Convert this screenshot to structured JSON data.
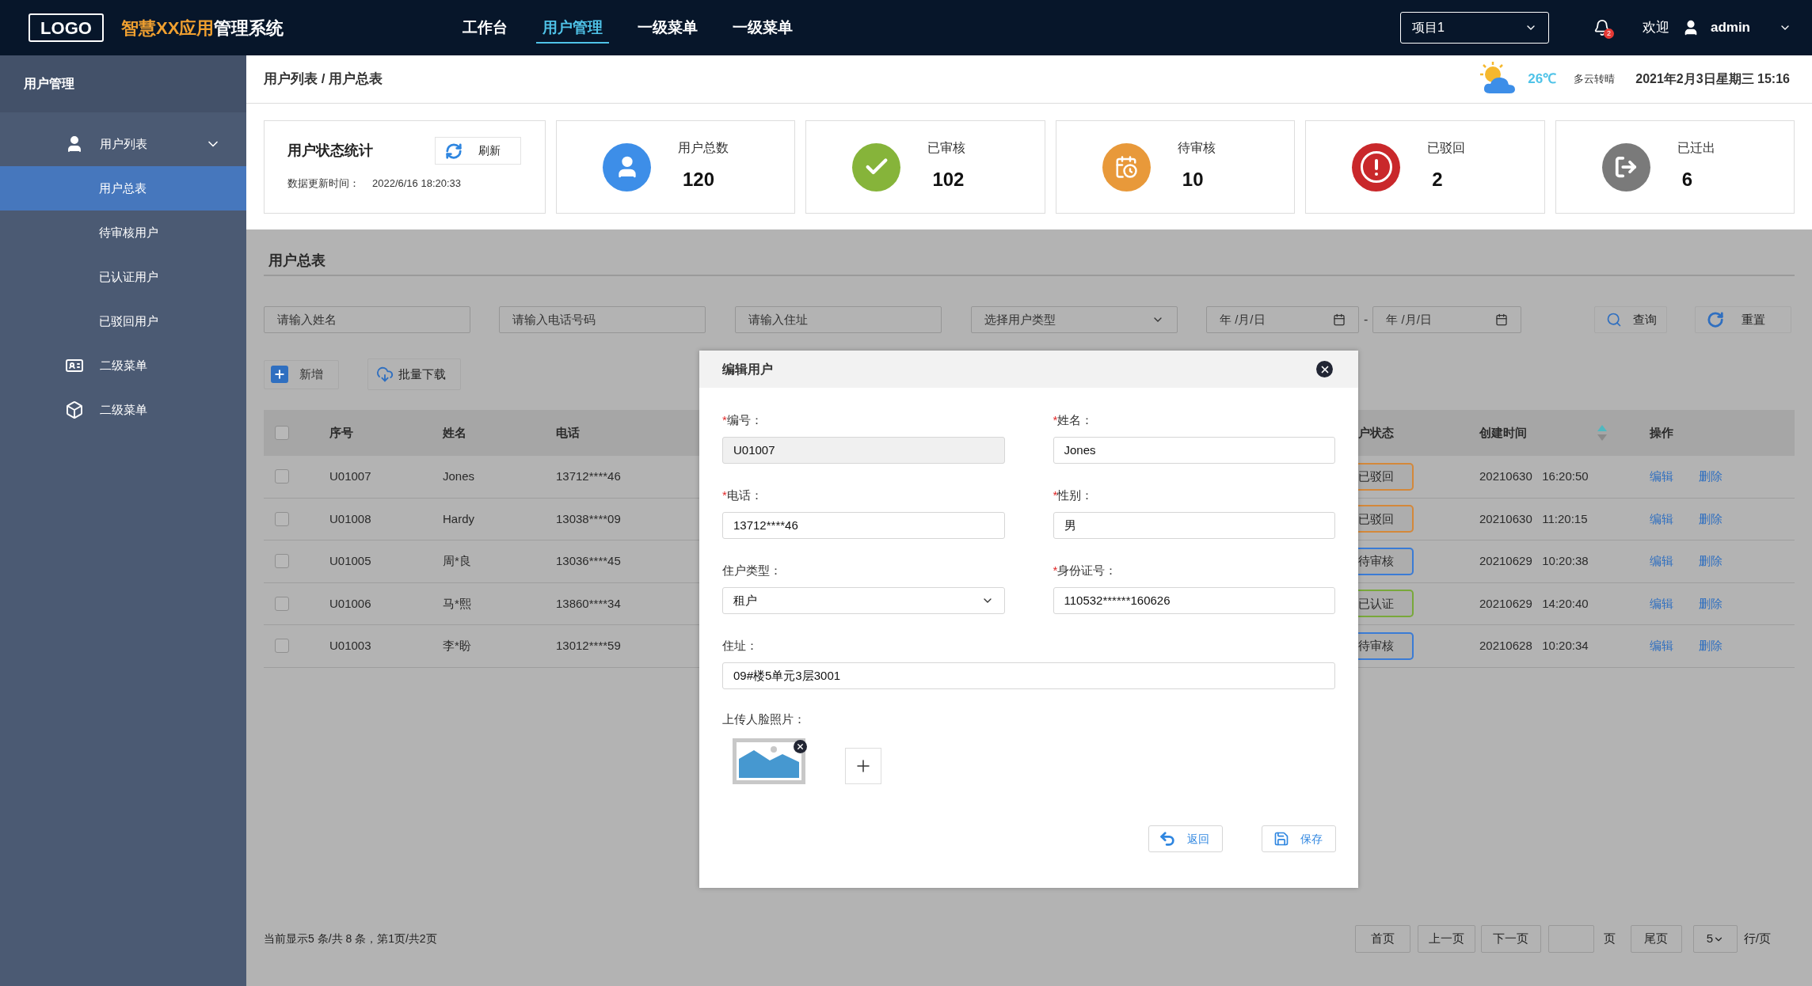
{
  "header": {
    "logo": "LOGO",
    "title_accent": "智慧XX应用",
    "title_rest": "管理系统",
    "nav": [
      {
        "label": "工作台",
        "selected": false
      },
      {
        "label": "用户管理",
        "selected": true
      },
      {
        "label": "一级菜单",
        "selected": false
      },
      {
        "label": "一级菜单",
        "selected": false
      }
    ],
    "project": "项目1",
    "notification_count": "2",
    "welcome": "欢迎",
    "user": "admin"
  },
  "sidebar": {
    "title": "用户管理",
    "items": [
      {
        "label": "用户列表",
        "expanded": true,
        "children": [
          {
            "label": "用户总表",
            "selected": true
          },
          {
            "label": "待审核用户",
            "selected": false
          },
          {
            "label": "已认证用户",
            "selected": false
          },
          {
            "label": "已驳回用户",
            "selected": false
          }
        ]
      },
      {
        "label": "二级菜单"
      },
      {
        "label": "二级菜单"
      }
    ]
  },
  "breadcrumb": "用户列表 / 用户总表",
  "weather": {
    "temperature": "26℃",
    "condition": "多云转晴"
  },
  "datetime": "2021年2月3日星期三 15:16",
  "stats": {
    "title": "用户状态统计",
    "refresh": "刷新",
    "updated_label": "数据更新时间：",
    "updated_value": "2022/6/16 18:20:33",
    "cards": [
      {
        "label": "用户总数",
        "value": "120"
      },
      {
        "label": "已审核",
        "value": "102"
      },
      {
        "label": "待审核",
        "value": "10"
      },
      {
        "label": "已驳回",
        "value": "2"
      },
      {
        "label": "已迁出",
        "value": "6"
      }
    ]
  },
  "section_title": "用户总表",
  "filters": {
    "name_placeholder": "请输入姓名",
    "phone_placeholder": "请输入电话号码",
    "address_placeholder": "请输入住址",
    "type_placeholder": "选择用户类型",
    "date_from": "年 /月/日",
    "separator": "-",
    "date_to": "年 /月/日",
    "search": "查询",
    "reset": "重置"
  },
  "actions": {
    "add": "新增",
    "download": "批量下载"
  },
  "table": {
    "select_all": {
      "checked": false
    },
    "columns": [
      {
        "label": "序号"
      },
      {
        "label": "姓名"
      },
      {
        "label": "电话"
      },
      {
        "label": "户状态"
      },
      {
        "label": "创建时间",
        "sort_ascending": true
      },
      {
        "label": "操作"
      }
    ],
    "rows": [
      {
        "checked": false,
        "id": "U01007",
        "name": "Jones",
        "phone": "13712****46",
        "status": "已驳回",
        "color": "#d4883a",
        "created": "20210630   16:20:50",
        "edit": "编辑",
        "delete": "删除"
      },
      {
        "checked": false,
        "id": "U01008",
        "name": "Hardy",
        "phone": "13038****09",
        "status": "已驳回",
        "color": "#d4883a",
        "created": "20210630   11:20:15",
        "edit": "编辑",
        "delete": "删除"
      },
      {
        "checked": false,
        "id": "U01005",
        "name": "周*良",
        "phone": "13036****45",
        "status": "待审核",
        "color": "#3a7bd5",
        "created": "20210629   10:20:38",
        "edit": "编辑",
        "delete": "删除"
      },
      {
        "checked": false,
        "id": "U01006",
        "name": "马*熙",
        "phone": "13860****34",
        "status": "已认证",
        "color": "#78a83a",
        "created": "20210629   14:20:40",
        "edit": "编辑",
        "delete": "删除"
      },
      {
        "checked": false,
        "id": "U01003",
        "name": "李*盼",
        "phone": "13012****59",
        "status": "待审核",
        "color": "#3a7bd5",
        "created": "20210628   10:20:34",
        "edit": "编辑",
        "delete": "删除"
      }
    ]
  },
  "pagination": {
    "summary": "当前显示5 条/共 8 条，第1页/共2页",
    "first": "首页",
    "prev": "上一页",
    "next": "下一页",
    "page_unit": "页",
    "last": "尾页",
    "page_size": "5",
    "page_size_unit": "行/页"
  },
  "modal": {
    "title": "编辑用户",
    "fields": [
      {
        "label": "编号：",
        "required_mark": "*",
        "kind": "input",
        "disabled": true,
        "value": "U01007"
      },
      {
        "label": "姓名：",
        "required_mark": "*",
        "kind": "input",
        "disabled": false,
        "value": "Jones"
      },
      {
        "label": "电话：",
        "required_mark": "*",
        "kind": "input",
        "disabled": false,
        "value": "13712****46"
      },
      {
        "label": "性别：",
        "required_mark": "*",
        "kind": "input",
        "disabled": false,
        "value": "男"
      },
      {
        "label": "住户类型：",
        "kind": "select",
        "disabled": false,
        "value": "租户"
      },
      {
        "label": "身份证号：",
        "required_mark": "*",
        "kind": "input",
        "disabled": false,
        "value": "110532******160626"
      },
      {
        "label": "住址：",
        "kind": "wide",
        "disabled": false,
        "value": "09#楼5单元3层3001"
      }
    ],
    "upload_label": "上传人脸照片：",
    "cancel": "返回",
    "save": "保存"
  }
}
